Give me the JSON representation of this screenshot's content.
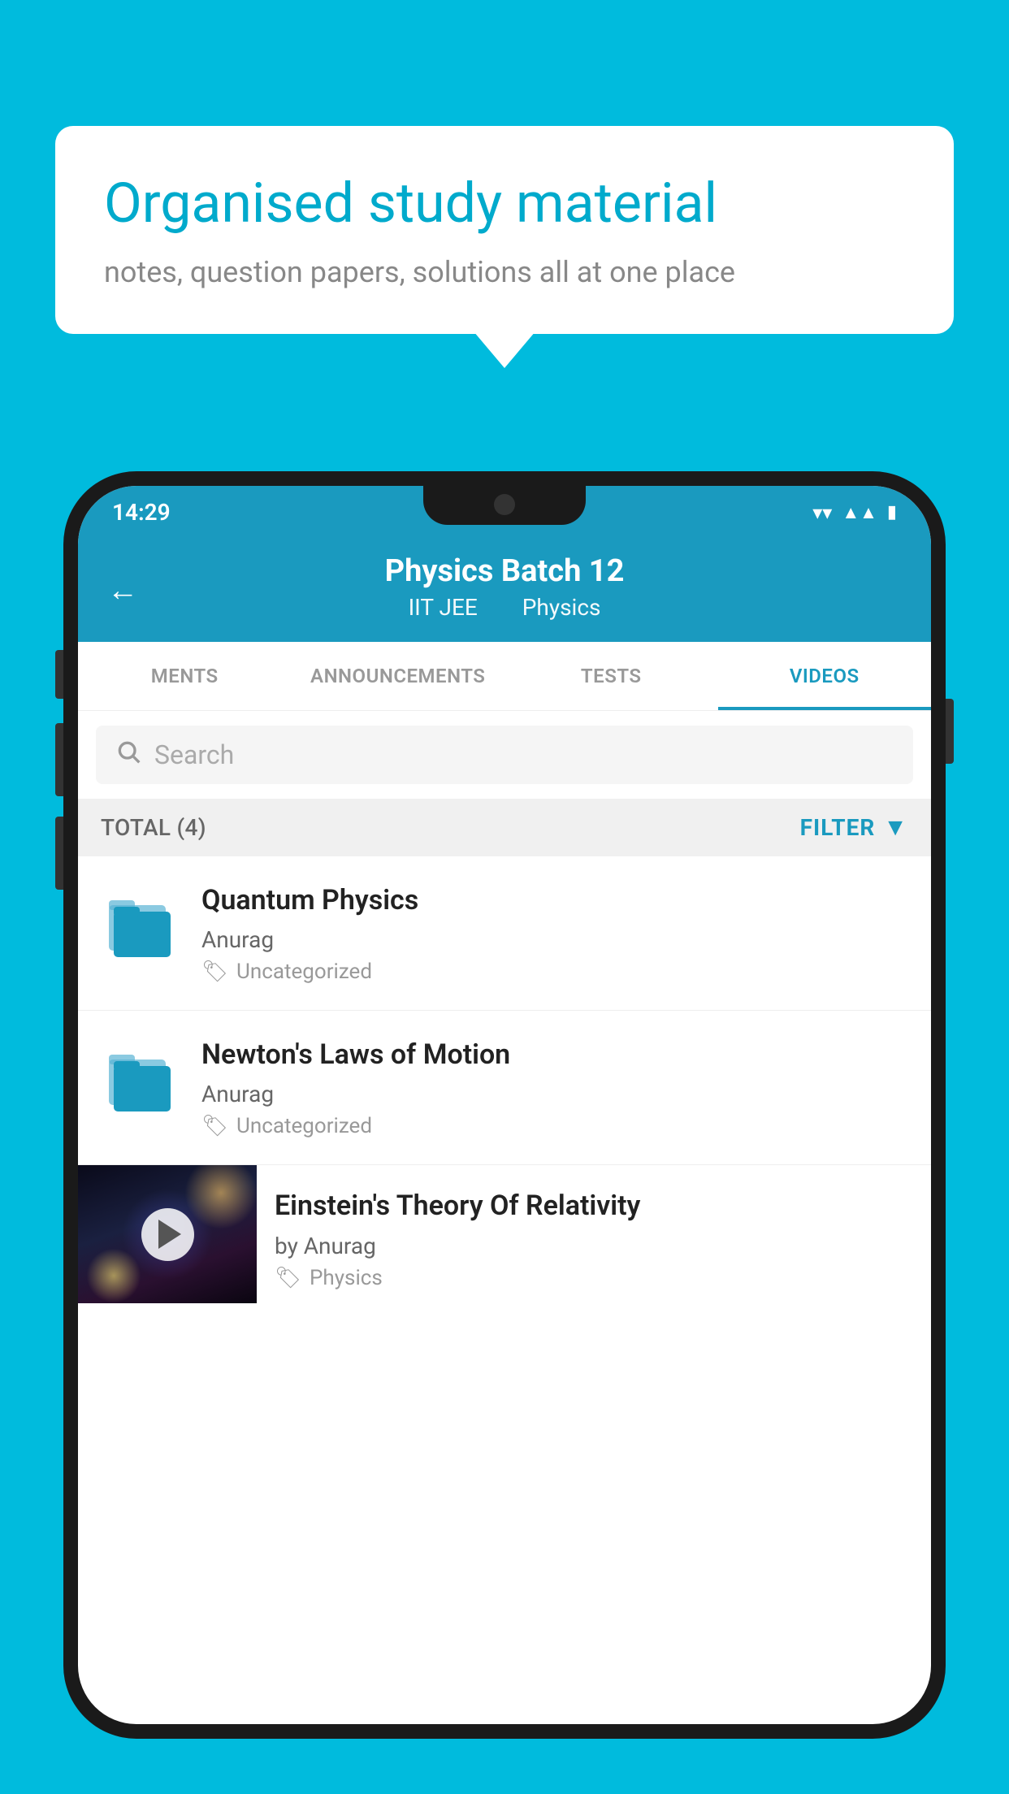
{
  "background": {
    "color": "#00BBDD"
  },
  "speech_bubble": {
    "title": "Organised study material",
    "subtitle": "notes, question papers, solutions all at one place"
  },
  "phone": {
    "status_bar": {
      "time": "14:29"
    },
    "header": {
      "title": "Physics Batch 12",
      "subtitle_part1": "IIT JEE",
      "subtitle_part2": "Physics",
      "back_label": "←"
    },
    "tabs": [
      {
        "label": "MENTS",
        "active": false
      },
      {
        "label": "ANNOUNCEMENTS",
        "active": false
      },
      {
        "label": "TESTS",
        "active": false
      },
      {
        "label": "VIDEOS",
        "active": true
      }
    ],
    "search": {
      "placeholder": "Search"
    },
    "filter_bar": {
      "total_label": "TOTAL (4)",
      "filter_label": "FILTER"
    },
    "videos": [
      {
        "title": "Quantum Physics",
        "author": "Anurag",
        "tag": "Uncategorized",
        "has_thumbnail": false
      },
      {
        "title": "Newton's Laws of Motion",
        "author": "Anurag",
        "tag": "Uncategorized",
        "has_thumbnail": false
      },
      {
        "title": "Einstein's Theory Of Relativity",
        "author": "by Anurag",
        "tag": "Physics",
        "has_thumbnail": true
      }
    ]
  }
}
